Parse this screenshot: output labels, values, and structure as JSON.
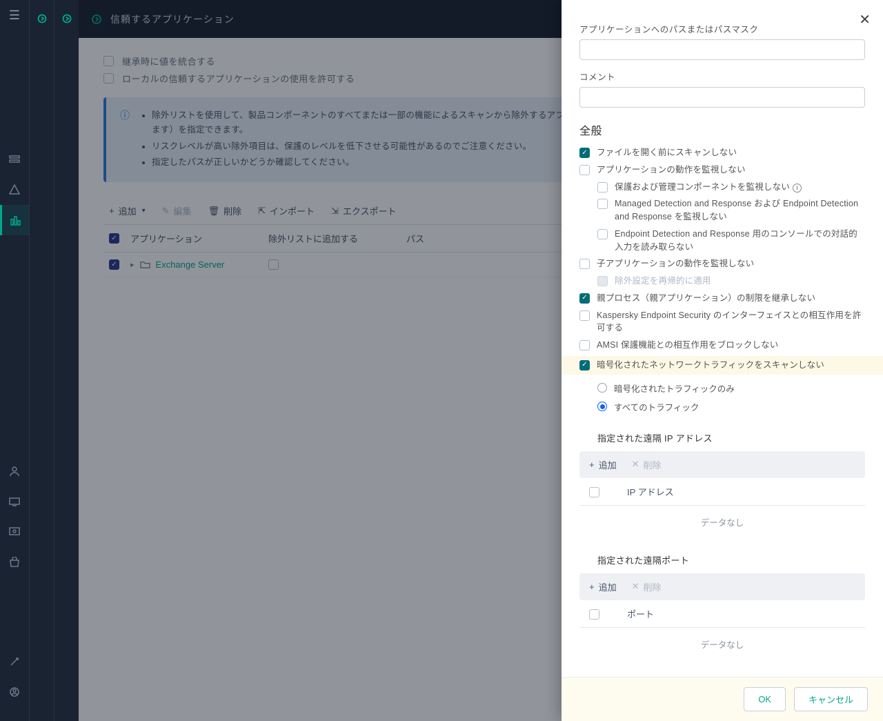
{
  "header": {
    "title": "信頼するアプリケーション"
  },
  "topChecks": {
    "merge": "継承時に値を統合する",
    "allowLocal": "ローカルの信頼するアプリケーションの使用を許可する"
  },
  "infoBox": {
    "line1": "除外リストを使用して、製品コンポーネントのすべてまたは一部の機能によるスキャンから除外するアプリケーション（アプリケーション名は Kaspersky が定める規則に従います）を指定できます。",
    "line2": "リスクレベルが高い除外項目は、保護のレベルを低下させる可能性があるのでご注意ください。",
    "line3": "指定したパスが正しいかどうか確認してください。"
  },
  "toolbar": {
    "add": "追加",
    "edit": "編集",
    "delete": "削除",
    "import": "インポート",
    "export": "エクスポート"
  },
  "table": {
    "col1": "アプリケーション",
    "col2": "除外リストに追加する",
    "col3": "パス",
    "row1": {
      "name": "Exchange Server"
    }
  },
  "panel": {
    "pathLabel": "アプリケーションへのパスまたはパスマスク",
    "commentLabel": "コメント",
    "generalTitle": "全般",
    "opts": {
      "noScanOpen": "ファイルを開く前にスキャンしない",
      "noMonitorApp": "アプリケーションの動作を監視しない",
      "noMonitorProtect": "保護および管理コンポーネントを監視しない",
      "noMdr": "Managed Detection and Response および Endpoint Detection and Response を監視しない",
      "noEdrConsole": "Endpoint Detection and Response 用のコンソールでの対話的入力を読み取らない",
      "noMonitorChild": "子アプリケーションの動作を監視しない",
      "recursExcl": "除外設定を再帰的に適用",
      "noInheritParent": "親プロセス（親アプリケーション）の制限を継承しない",
      "allowKesUi": "Kaspersky Endpoint Security のインターフェイスとの相互作用を許可する",
      "noBlockAmsi": "AMSI 保護機能との相互作用をブロックしない",
      "noScanEncTraffic": "暗号化されたネットワークトラフィックをスキャンしない"
    },
    "radios": {
      "encOnly": "暗号化されたトラフィックのみ",
      "allTraffic": "すべてのトラフィック"
    },
    "remoteIp": {
      "title": "指定された遠隔 IP アドレス",
      "add": "追加",
      "delete": "削除",
      "col": "IP アドレス",
      "nodata": "データなし"
    },
    "remotePort": {
      "title": "指定された遠隔ポート",
      "add": "追加",
      "delete": "削除",
      "col": "ポート",
      "nodata": "データなし"
    },
    "footer": {
      "ok": "OK",
      "cancel": "キャンセル"
    }
  }
}
